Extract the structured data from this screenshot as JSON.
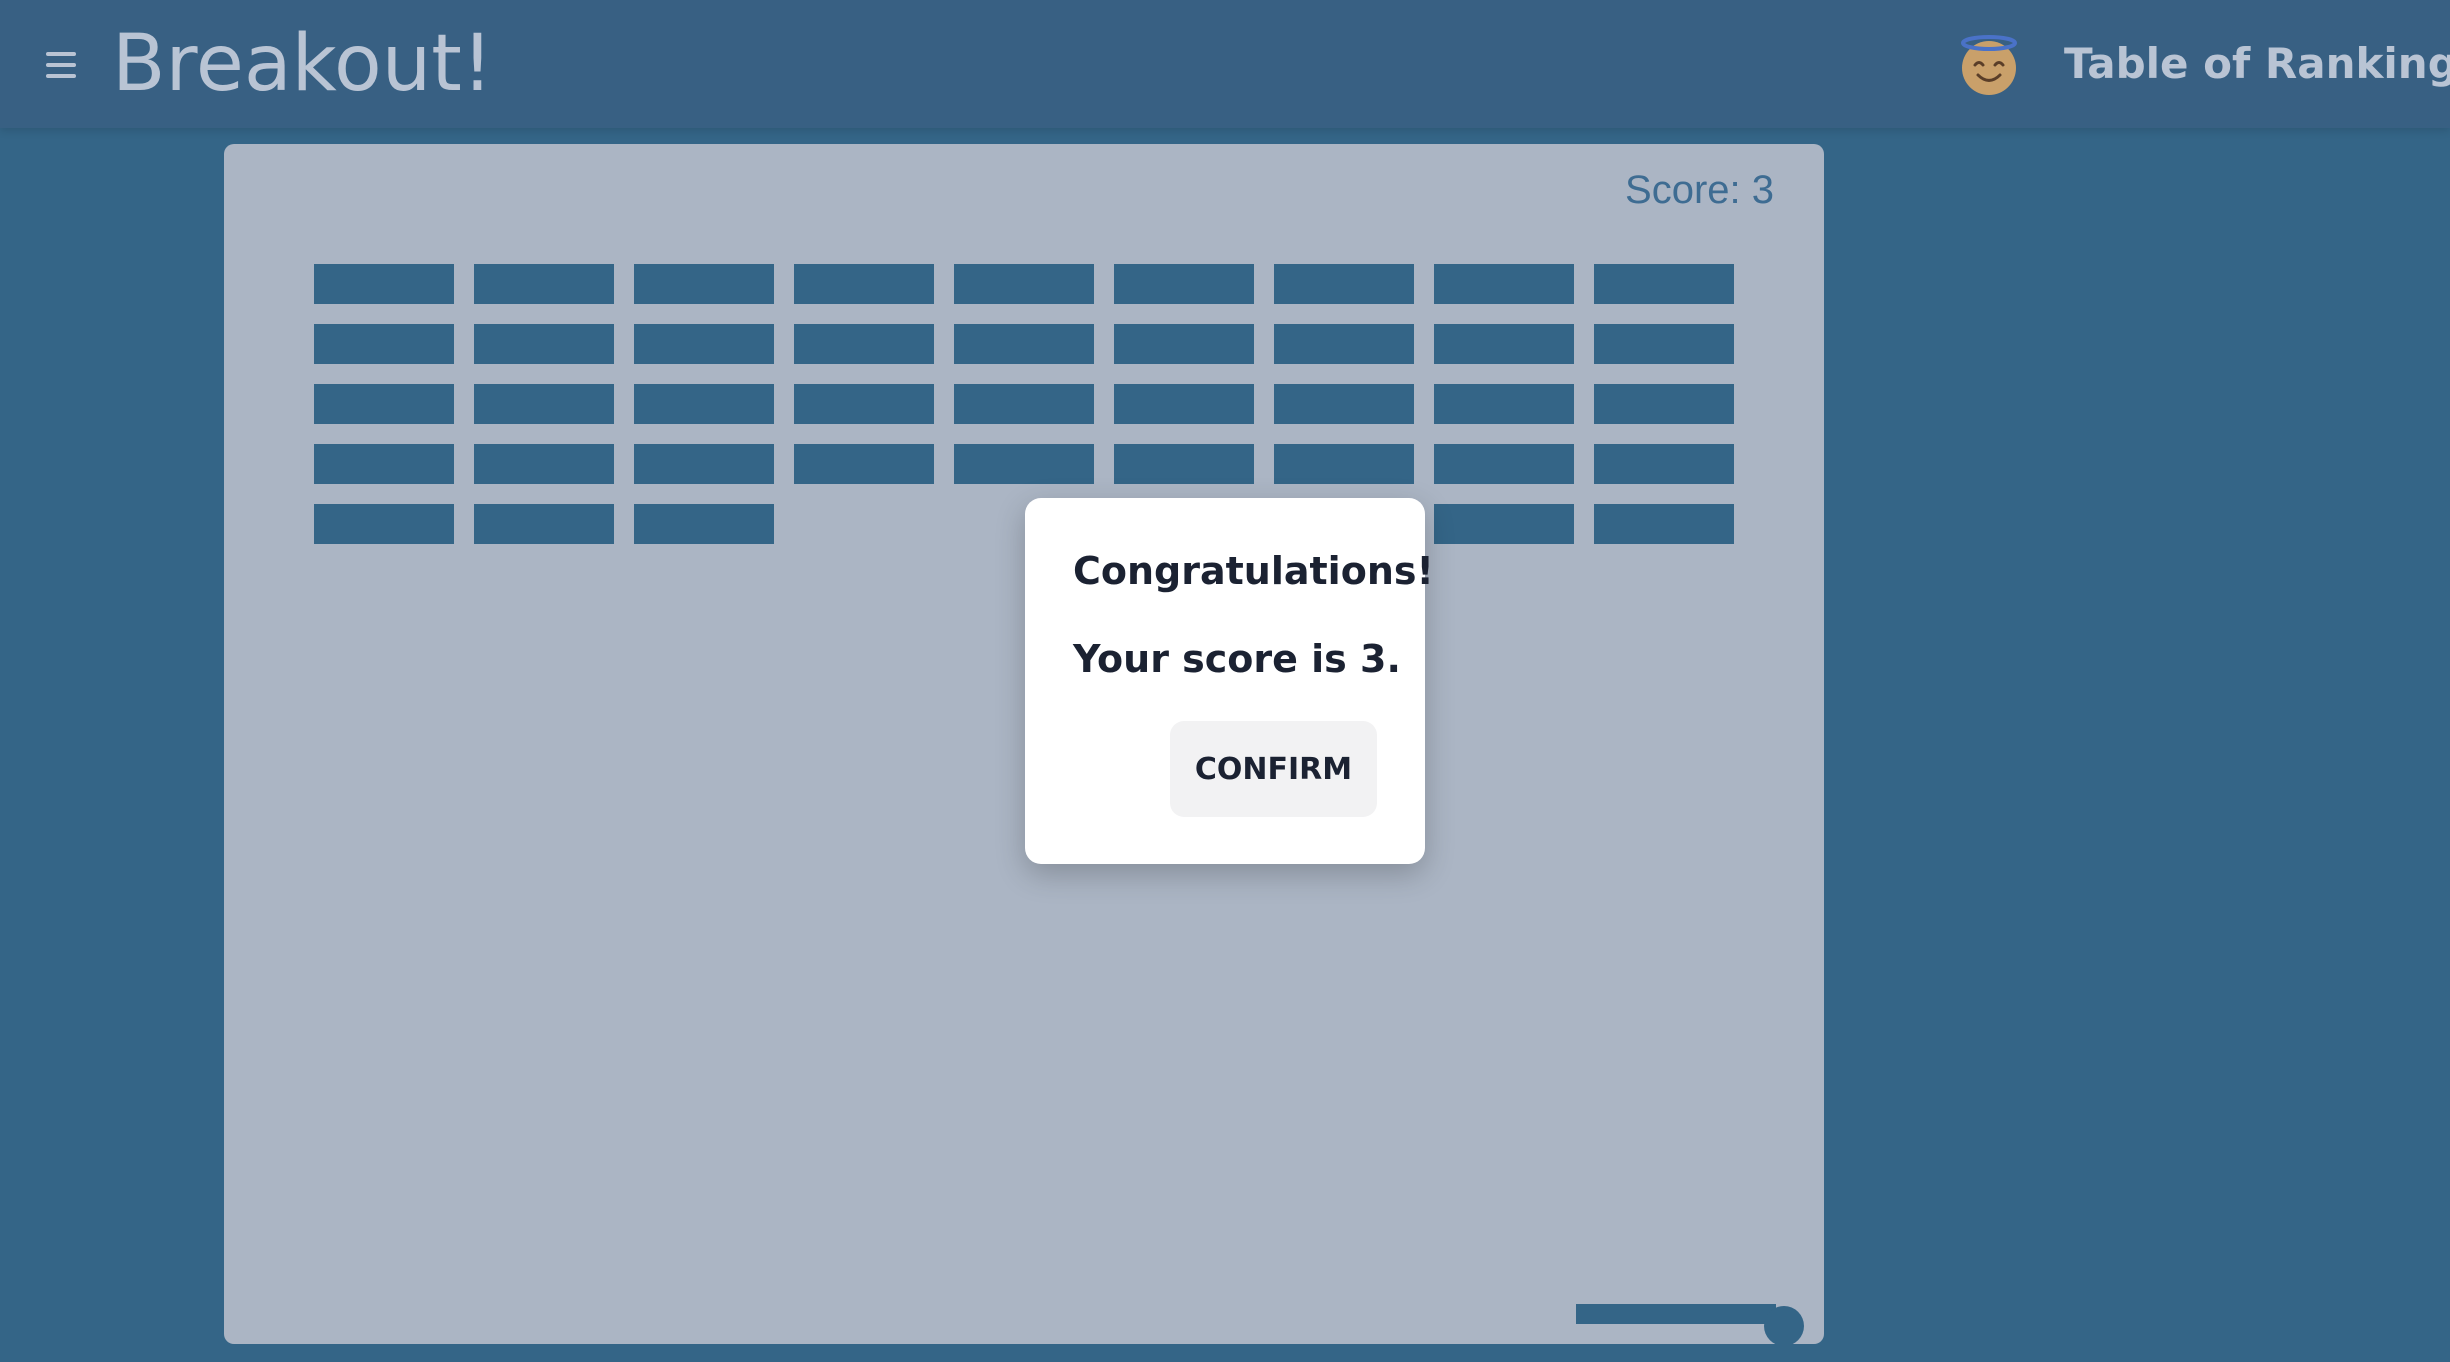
{
  "header": {
    "title": "Breakout!",
    "menu_icon": "hamburger-menu-icon",
    "avatar_icon": "smiling-face-with-halo-emoji",
    "ranking_link": "Table of Ranking"
  },
  "game": {
    "score_text": "Score: 3",
    "bricks": {
      "columns": 9,
      "rows": 5,
      "present": [
        [
          1,
          1,
          1,
          1,
          1,
          1,
          1,
          1,
          1
        ],
        [
          1,
          1,
          1,
          1,
          1,
          1,
          1,
          1,
          1
        ],
        [
          1,
          1,
          1,
          1,
          1,
          1,
          1,
          1,
          1
        ],
        [
          1,
          1,
          1,
          1,
          1,
          1,
          1,
          1,
          1
        ],
        [
          1,
          1,
          1,
          0,
          0,
          0,
          0,
          1,
          1
        ]
      ]
    }
  },
  "dialog": {
    "title": "Congratulations!",
    "message": "Your score is 3.",
    "confirm_label": "CONFIRM"
  },
  "colors": {
    "background": "#346587",
    "header": "#386083",
    "board": "#abb5c4",
    "brick": "#346587",
    "header_text": "#b9c4d4",
    "score_text": "#3e6c92",
    "dialog_text": "#1b2232"
  }
}
